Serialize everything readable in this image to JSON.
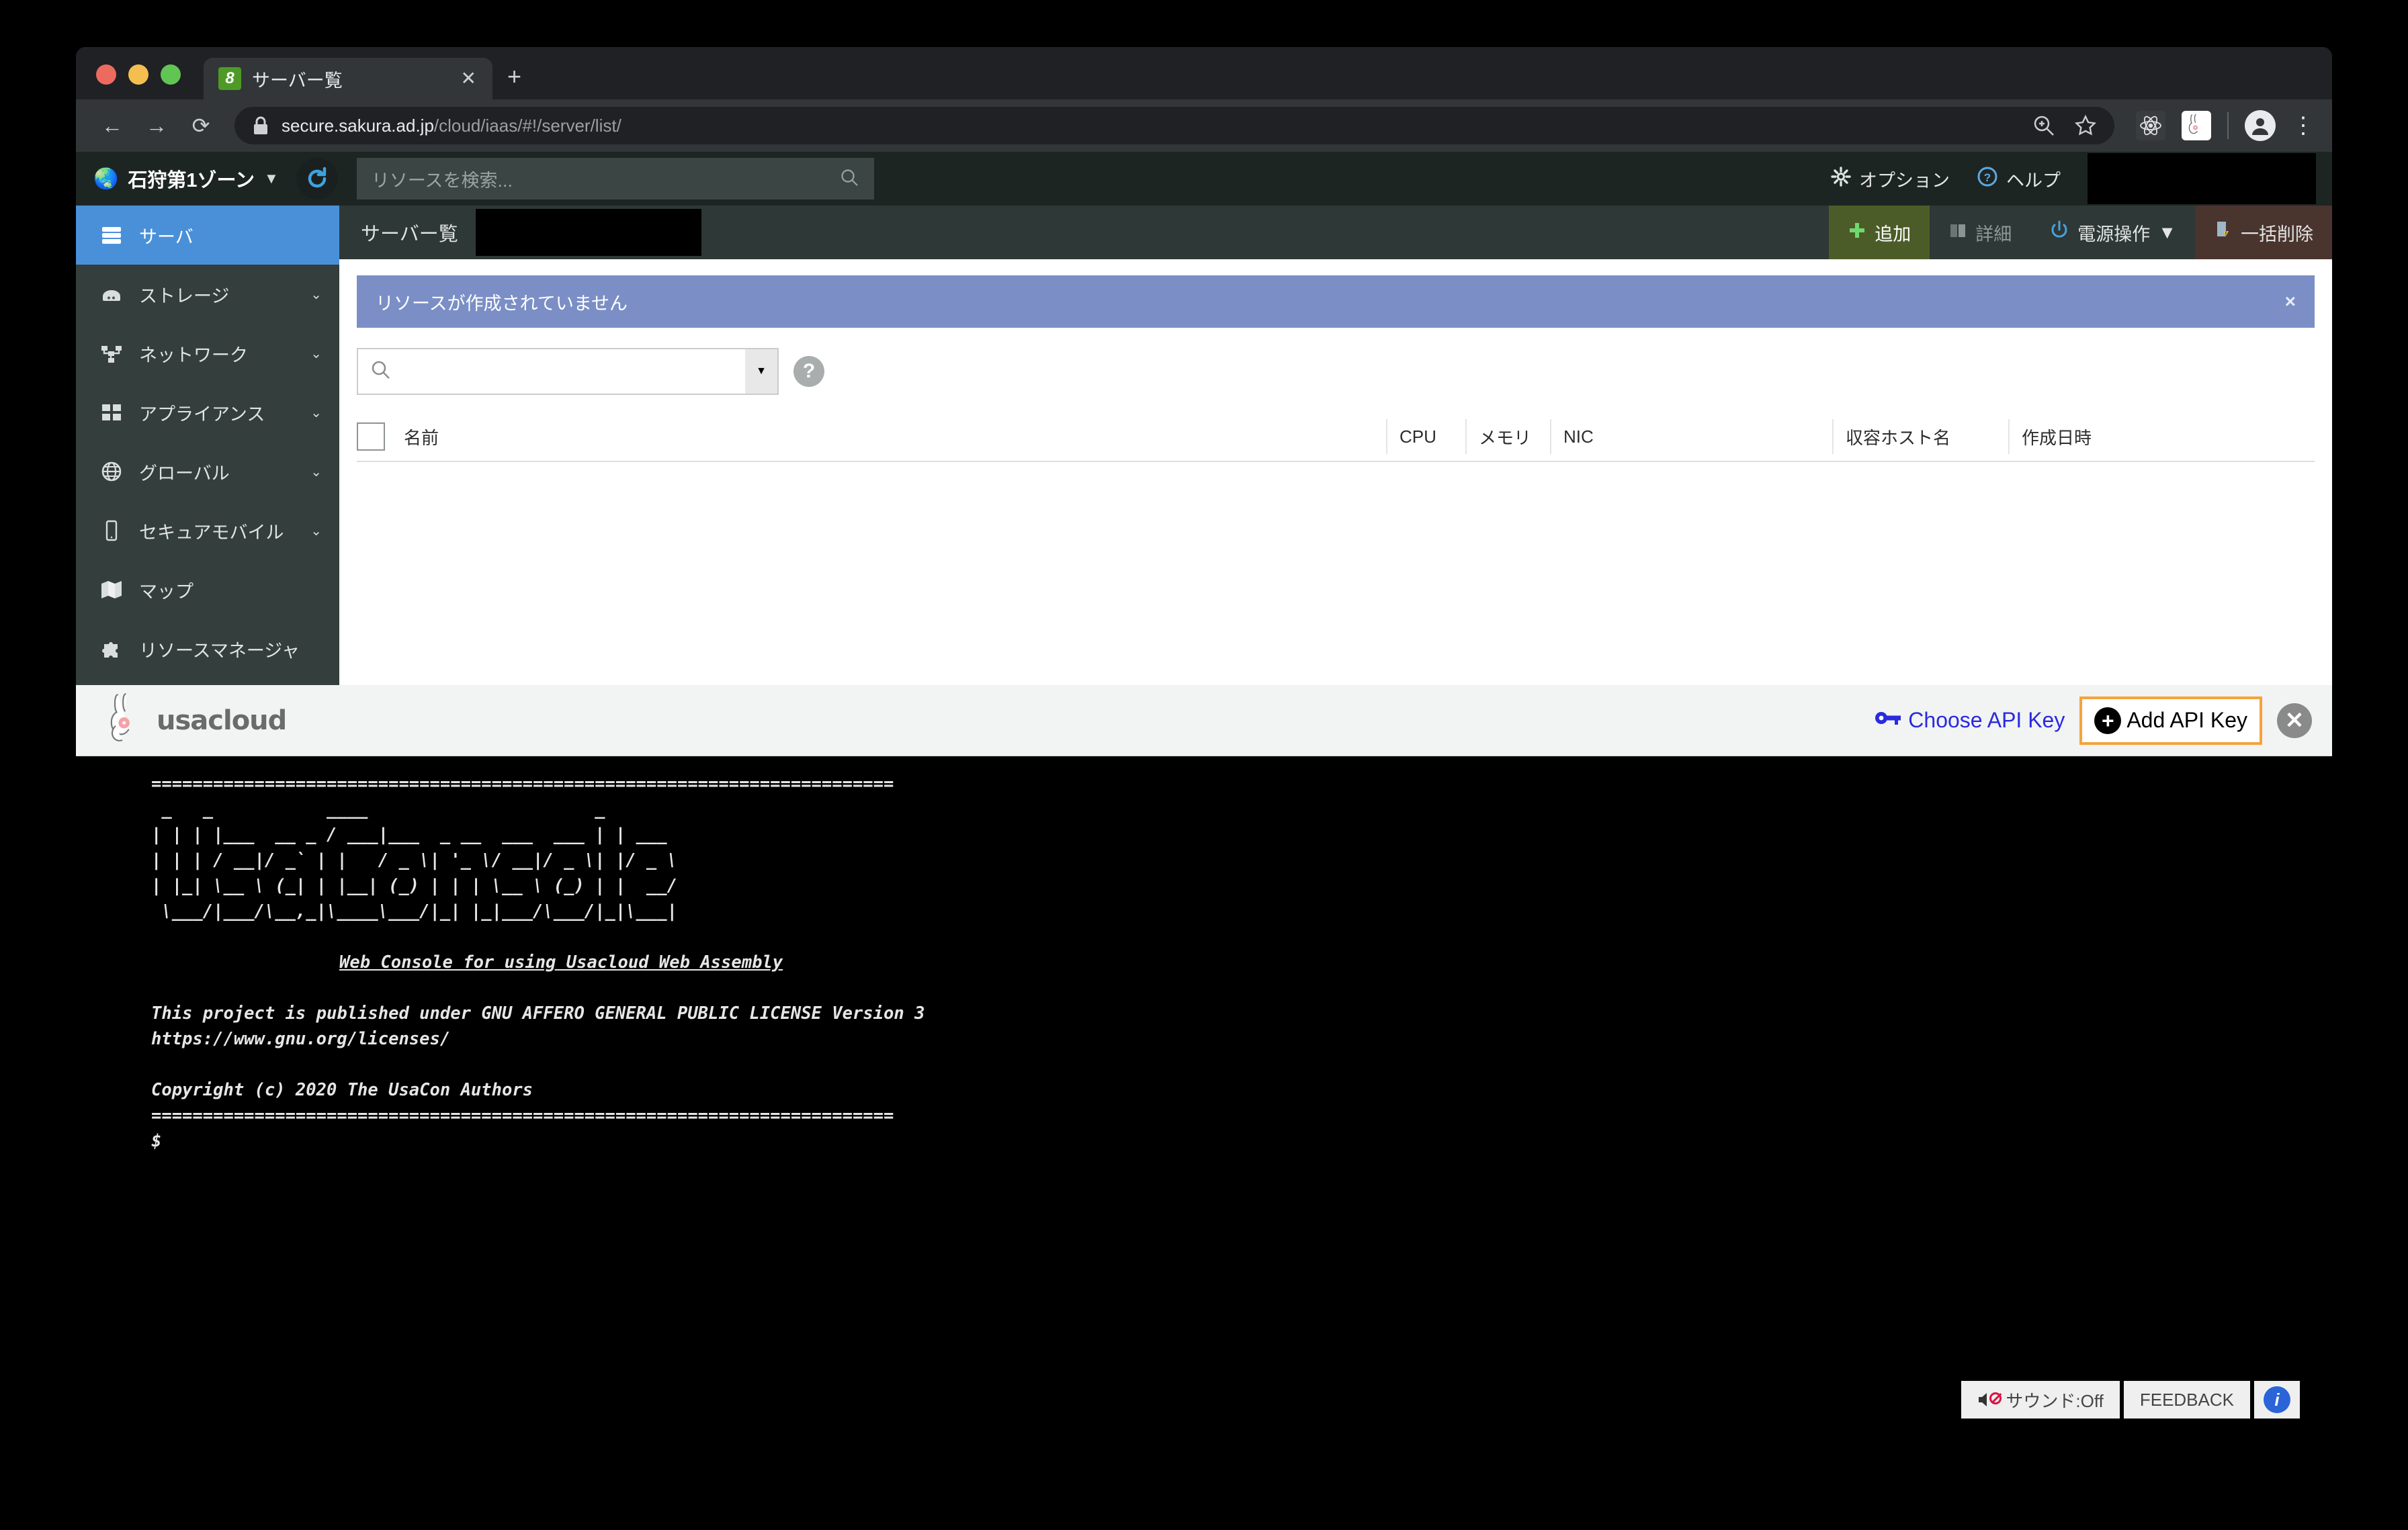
{
  "browser": {
    "tab": {
      "title": "サーバー覧",
      "favicon_glyph": "8",
      "close_label": "✕"
    },
    "new_tab_label": "+",
    "nav": {
      "back": "←",
      "forward": "→",
      "reload": "⟳"
    },
    "omnibox": {
      "host": "secure.sakura.ad.jp",
      "path": "/cloud/iaas/#!/server/list/"
    },
    "menu_dots": "⋮"
  },
  "app": {
    "zone": {
      "label": "石狩第1ゾーン",
      "caret": "▼"
    },
    "search": {
      "placeholder": "リソースを検索...",
      "value": ""
    },
    "topbar_links": [
      {
        "label": "オプション",
        "icon": "gear-icon"
      },
      {
        "label": "ヘルプ",
        "icon": "question-circle-icon"
      }
    ],
    "sidebar": [
      {
        "label": "サーバ",
        "icon": "server-icon",
        "active": true,
        "expandable": false
      },
      {
        "label": "ストレージ",
        "icon": "storage-icon",
        "active": false,
        "expandable": true
      },
      {
        "label": "ネットワーク",
        "icon": "network-icon",
        "active": false,
        "expandable": true
      },
      {
        "label": "アプライアンス",
        "icon": "appliance-icon",
        "active": false,
        "expandable": true
      },
      {
        "label": "グローバル",
        "icon": "globe-icon",
        "active": false,
        "expandable": true
      },
      {
        "label": "セキュアモバイル",
        "icon": "mobile-icon",
        "active": false,
        "expandable": true
      },
      {
        "label": "マップ",
        "icon": "map-icon",
        "active": false,
        "expandable": false
      },
      {
        "label": "リソースマネージャ",
        "icon": "puzzle-icon",
        "active": false,
        "expandable": false
      }
    ],
    "page_title": "サーバー覧",
    "toolbar": [
      {
        "label": "追加",
        "icon": "plus-icon",
        "style": "add"
      },
      {
        "label": "詳細",
        "icon": "book-icon",
        "style": "disabled"
      },
      {
        "label": "電源操作",
        "icon": "power-icon",
        "style": "normal",
        "caret": "▼"
      },
      {
        "label": "一括削除",
        "icon": "delete-icon",
        "style": "danger"
      }
    ],
    "alert": {
      "text": "リソースが作成されていません",
      "close": "×"
    },
    "filter": {
      "value": "",
      "dropdown_caret": "▼",
      "help_glyph": "?"
    },
    "table": {
      "columns": [
        "名前",
        "CPU",
        "メモリ",
        "NIC",
        "収容ホスト名",
        "作成日時"
      ],
      "rows": []
    }
  },
  "usacon": {
    "logo_text": "usacloud",
    "choose_api_key": "Choose API Key",
    "add_api_key": "Add API Key",
    "add_api_key_plus": "+",
    "close": "✕",
    "terminal": {
      "rule_top": "========================================================================",
      "ascii_banner": " _   _           ____                      _      \n| | | |___  __ _ / ___|___  _ __  ___  ___ | | ___ \n| | | / __|/ _` | |   / _ \\| '_ \\/ __|/ _ \\| |/ _ \\\n| |_| \\__ \\ (_| | |__| (_) | | | \\__ \\ (_) | |  __/\n \\___/|___/\\__,_|\\____\\___/|_| |_|___/\\___/|_|\\___|",
      "subtitle": "Web Console for using Usacloud Web Assembly",
      "license_line": "This project is published under GNU AFFERO GENERAL PUBLIC LICENSE Version 3",
      "license_url": "https://www.gnu.org/licenses/",
      "copyright": "Copyright (c) 2020 The UsaCon Authors",
      "rule_bottom": "========================================================================",
      "prompt": "$"
    },
    "statusbar": {
      "sound": "サウンド:Off",
      "feedback": "FEEDBACK",
      "info": "i"
    }
  }
}
